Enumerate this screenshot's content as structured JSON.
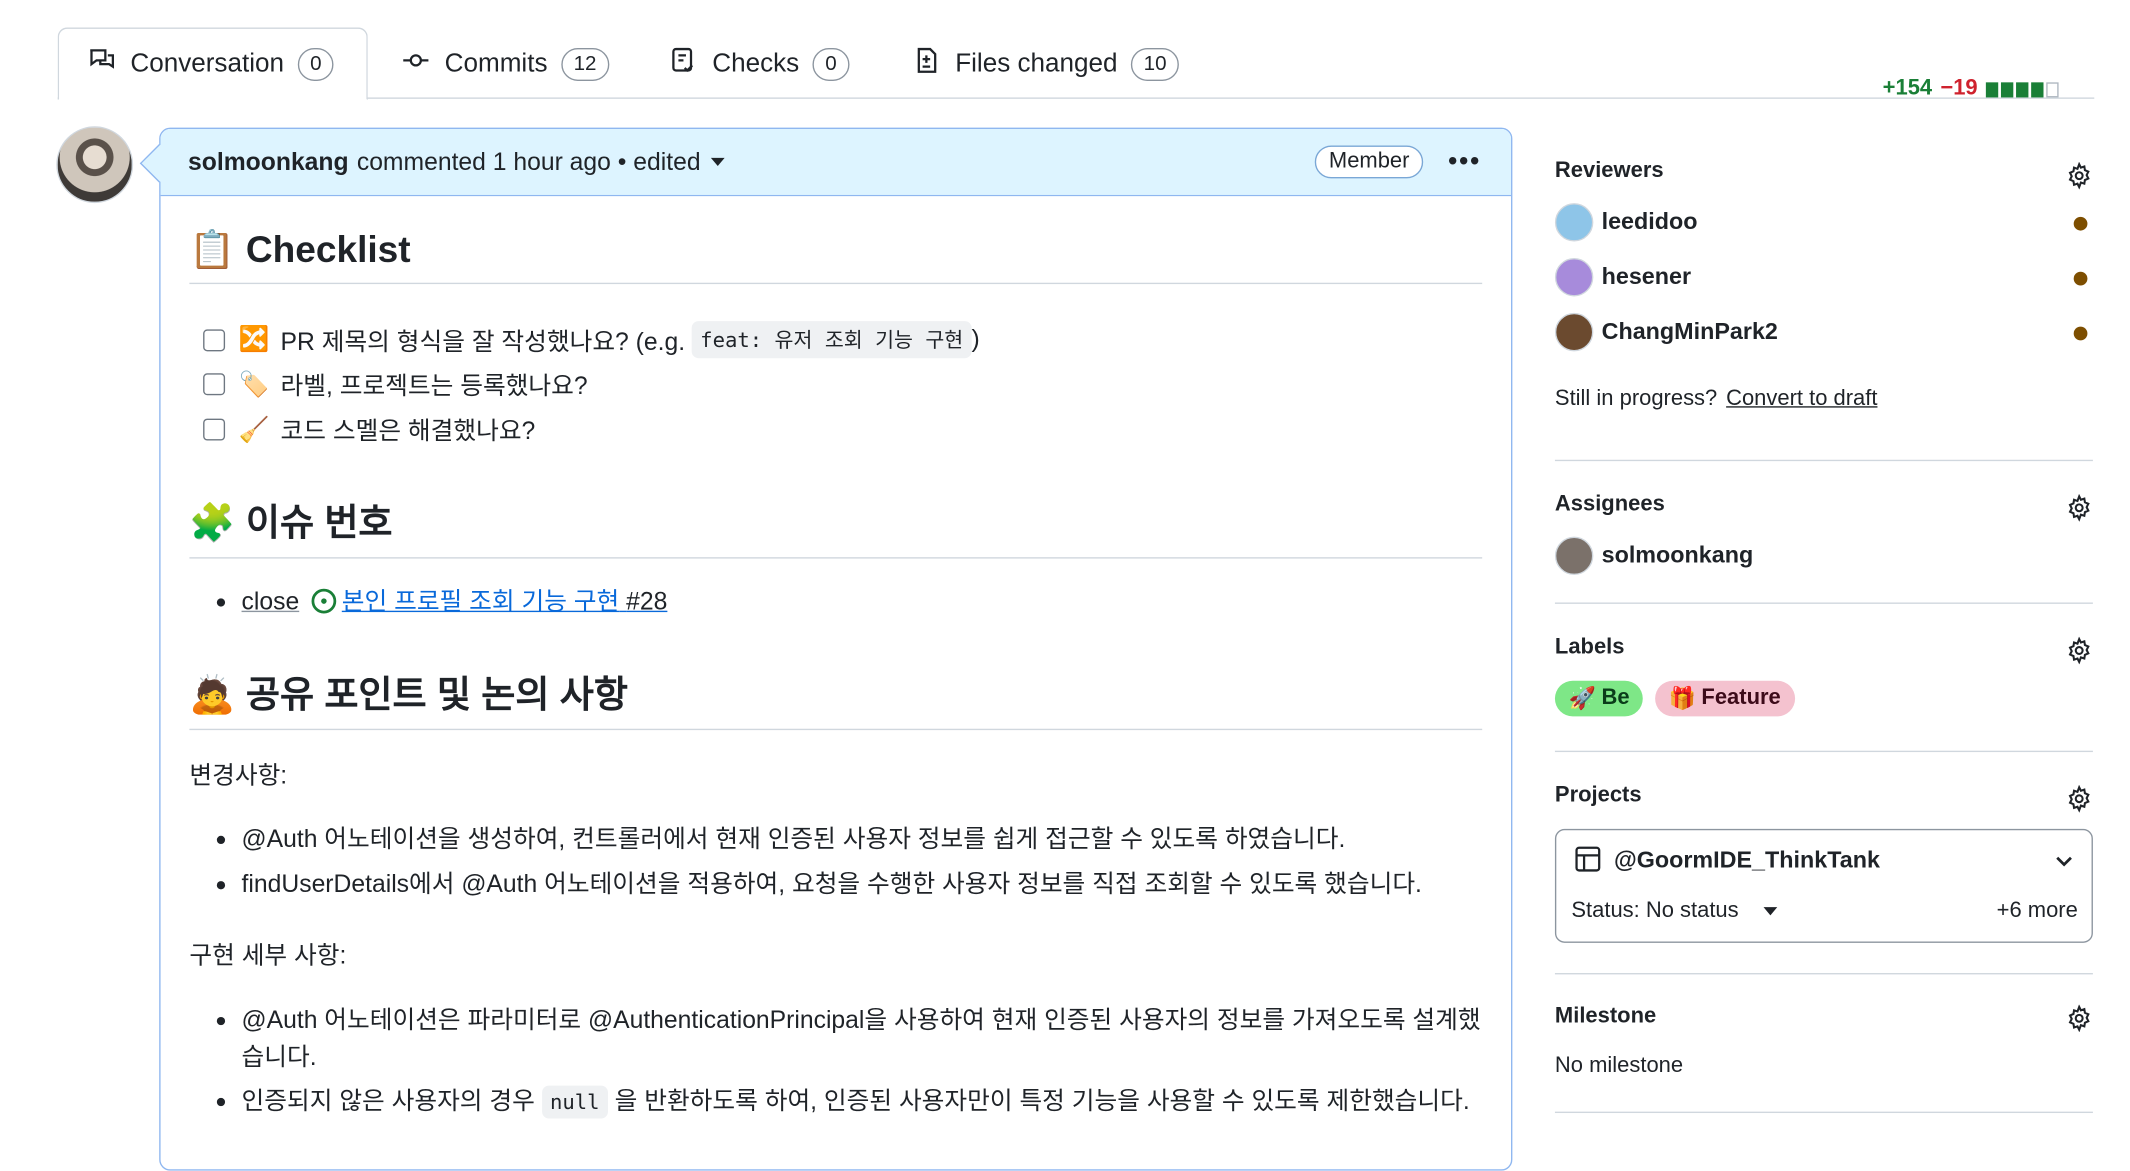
{
  "tabs": [
    {
      "label": "Conversation",
      "count": "0",
      "icon": "conversation-icon"
    },
    {
      "label": "Commits",
      "count": "12",
      "icon": "commit-icon"
    },
    {
      "label": "Checks",
      "count": "0",
      "icon": "checklist-icon"
    },
    {
      "label": "Files changed",
      "count": "10",
      "icon": "file-diff-icon"
    }
  ],
  "diffstat": {
    "additions": "+154",
    "deletions": "−19",
    "bar": [
      1,
      1,
      1,
      1,
      0
    ]
  },
  "comment": {
    "author": "solmoonkang",
    "meta": "commented 1 hour ago • edited",
    "badge": "Member",
    "menu": "•••"
  },
  "checklist": {
    "title": "Checklist",
    "emoji": "📋",
    "tasks": [
      {
        "emoji": "🔀",
        "text_before": "PR 제목의 형식을 잘 작성했나요? (e.g. ",
        "code": "feat: 유저 조회 기능 구현",
        "text_after": ")"
      },
      {
        "emoji": "🏷️",
        "text_before": "라벨, 프로젝트는 등록했나요?"
      },
      {
        "emoji": "🧹",
        "text_before": "코드 스멜은 해결했나요?"
      }
    ]
  },
  "issue": {
    "title": "이슈 번호",
    "emoji": "🧩",
    "close_word": "close",
    "issue_title": "본인 프로필 조회 기능 구현",
    "issue_number": "#28"
  },
  "share": {
    "title": "공유 포인트 및 논의 사항",
    "emoji": "🙇",
    "changes_heading": "변경사항:",
    "changes": [
      "@Auth 어노테이션을 생성하여, 컨트롤러에서 현재 인증된 사용자 정보를 쉽게 접근할 수 있도록 하였습니다.",
      "findUserDetails에서 @Auth 어노테이션을 적용하여, 요청을 수행한 사용자 정보를 직접 조회할 수 있도록 했습니다."
    ],
    "details_heading": "구현 세부 사항:",
    "detail1_line1": "@Auth 어노테이션은 파라미터로 @AuthenticationPrincipal을 사용하여 현재 인증된 사용자의 정보를 가져오도록 설계했",
    "detail1_line2": "습니다.",
    "detail2_before": "인증되지 않은 사용자의 경우 ",
    "detail2_code": "null",
    "detail2_after": " 을 반환하도록 하여, 인증된 사용자만이 특정 기능을 사용할 수 있도록 제한했습니다."
  },
  "sidebar": {
    "reviewers": {
      "title": "Reviewers",
      "items": [
        {
          "name": "leedidoo",
          "avatar_color": "#8ec5e8"
        },
        {
          "name": "hesener",
          "avatar_color": "#a78bdb"
        },
        {
          "name": "ChangMinPark2",
          "avatar_color": "#6b4a2f"
        }
      ],
      "draft_prefix": "Still in progress?",
      "draft_link": "Convert to draft"
    },
    "assignees": {
      "title": "Assignees",
      "items": [
        {
          "name": "solmoonkang"
        }
      ]
    },
    "labels": {
      "title": "Labels",
      "items": [
        {
          "emoji": "🚀",
          "text": "Be",
          "bg": "#7ee787",
          "color": "#0b3d1a"
        },
        {
          "emoji": "🎁",
          "text": "Feature",
          "bg": "#f4c2cf",
          "color": "#3d0b1a"
        }
      ]
    },
    "projects": {
      "title": "Projects",
      "project_name": "@GoormIDE_ThinkTank",
      "status": "Status: No status",
      "more": "+6 more"
    },
    "milestone": {
      "title": "Milestone",
      "value": "No milestone"
    }
  }
}
